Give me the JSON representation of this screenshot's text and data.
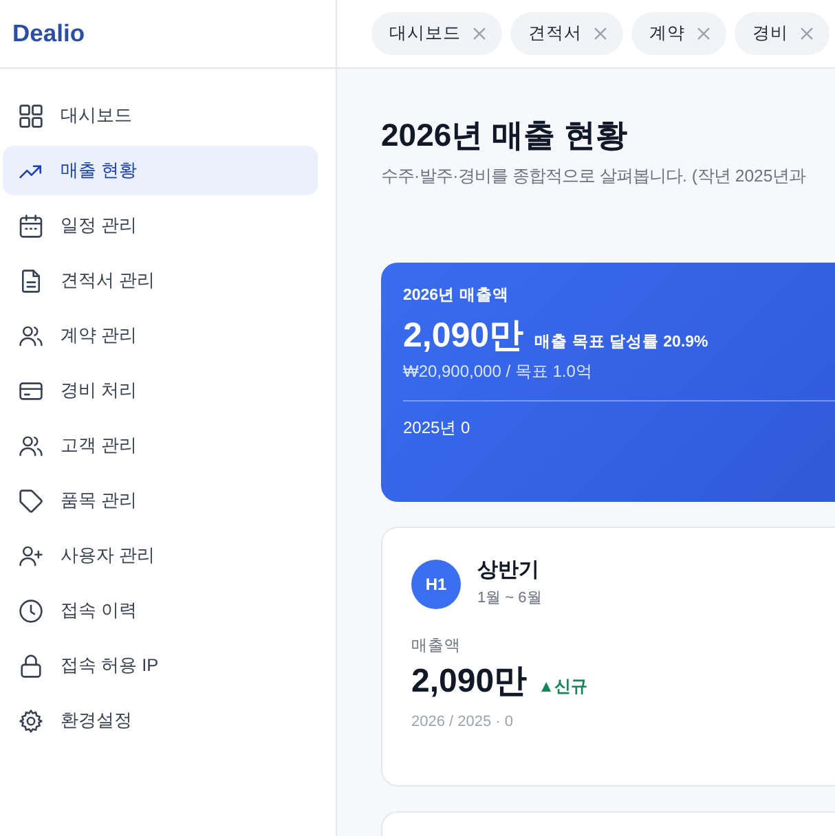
{
  "app": {
    "logo": "Dealio"
  },
  "tabs": [
    {
      "label": "대시보드",
      "selected": false
    },
    {
      "label": "견적서",
      "selected": false
    },
    {
      "label": "계약",
      "selected": false
    },
    {
      "label": "경비",
      "selected": false
    }
  ],
  "sidebar": {
    "items": [
      {
        "label": "대시보드",
        "selected": false
      },
      {
        "label": "매출 현황",
        "selected": true
      },
      {
        "label": "일정 관리",
        "selected": false
      },
      {
        "label": "견적서 관리",
        "selected": false
      },
      {
        "label": "계약 관리",
        "selected": false
      },
      {
        "label": "경비 처리",
        "selected": false
      },
      {
        "label": "고객 관리",
        "selected": false
      },
      {
        "label": "품목 관리",
        "selected": false
      },
      {
        "label": "사용자 관리",
        "selected": false
      },
      {
        "label": "접속 이력",
        "selected": false
      },
      {
        "label": "접속 허용 IP",
        "selected": false
      },
      {
        "label": "환경설정",
        "selected": false
      }
    ]
  },
  "page": {
    "title": "2026년 매출 현황",
    "subtitle": "수주·발주·경비를 종합적으로 살펴봅니다. (작년 2025년과"
  },
  "summary_card": {
    "label": "2026년 매출액",
    "amount": "2,090만",
    "goal_rate": "매출 목표 달성률 20.9%",
    "detail": "₩20,900,000 / 목표 1.0억",
    "previous": "2025년 0"
  },
  "period_cards": [
    {
      "badge": "H1",
      "title": "상반기",
      "range": "1월 ~ 6월",
      "metric_label": "매출액",
      "value": "2,090만",
      "change": "▲신규",
      "footnote": "2026 / 2025 · 0"
    }
  ]
}
